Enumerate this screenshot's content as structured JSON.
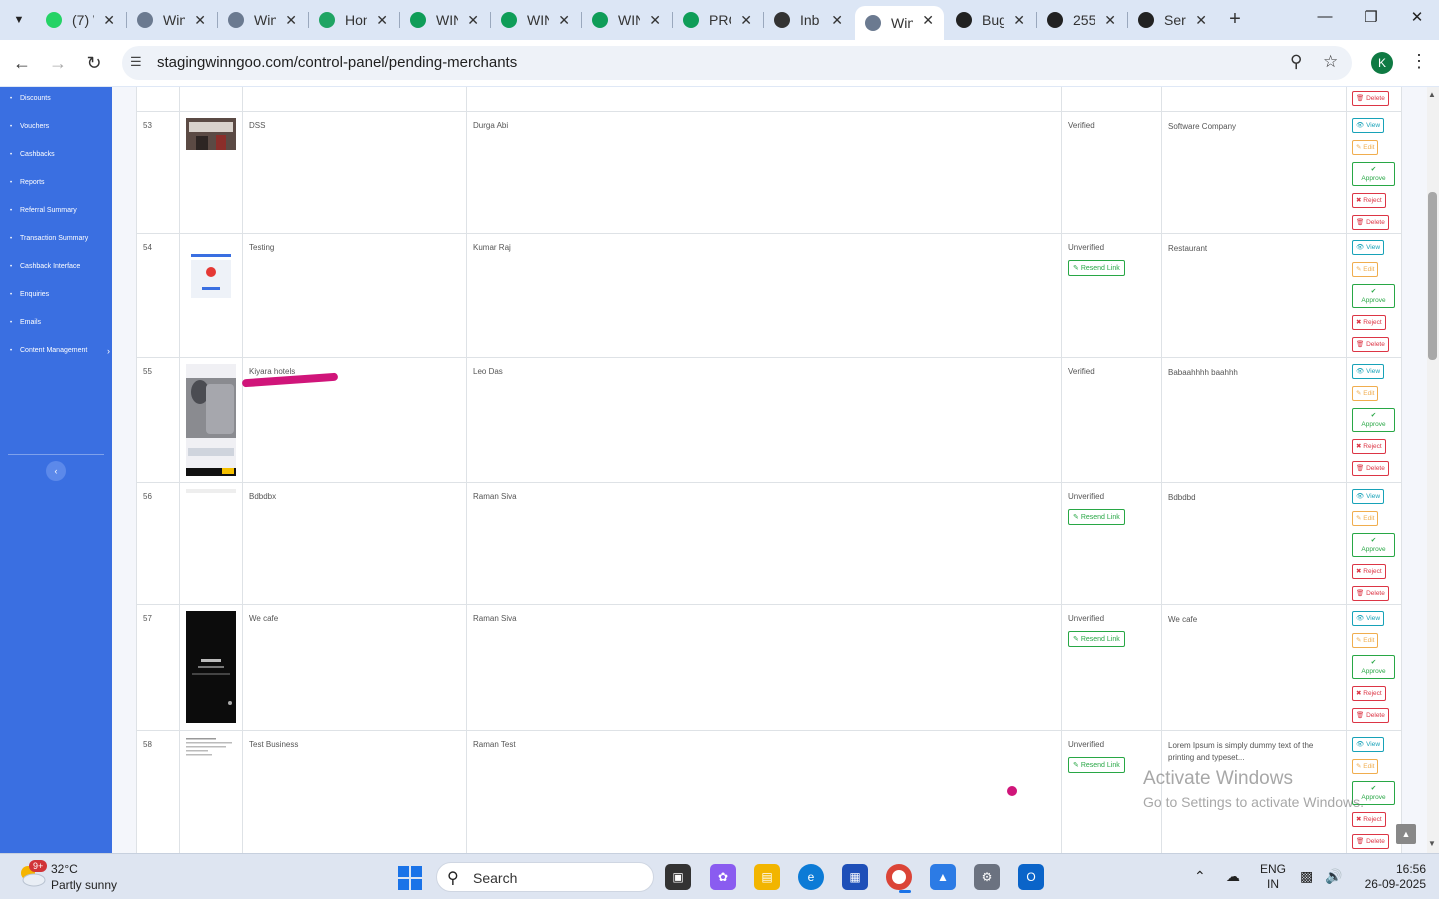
{
  "browser": {
    "tabs": [
      {
        "title": "(7) W",
        "favicon": "whatsapp-icon",
        "color": "#25d366"
      },
      {
        "title": "Win",
        "favicon": "globe-icon",
        "color": "#6b7a90"
      },
      {
        "title": "Win",
        "favicon": "globe-icon",
        "color": "#6b7a90"
      },
      {
        "title": "Hon",
        "favicon": "google-drive-icon",
        "color": "#1fa463"
      },
      {
        "title": "WIN",
        "favicon": "sheets-icon",
        "color": "#0f9d58"
      },
      {
        "title": "WIN",
        "favicon": "sheets-icon",
        "color": "#0f9d58"
      },
      {
        "title": "WIN",
        "favicon": "sheets-icon",
        "color": "#0f9d58"
      },
      {
        "title": "PRC",
        "favicon": "sheets-icon",
        "color": "#0f9d58"
      },
      {
        "title": "Inb",
        "favicon": "yahoo-icon",
        "color": "#333333"
      },
      {
        "title": "Win",
        "favicon": "globe-icon",
        "color": "#6b7a90"
      },
      {
        "title": "Bug",
        "favicon": "openai-icon",
        "color": "#222222"
      },
      {
        "title": "255",
        "favicon": "openai-icon",
        "color": "#222222"
      },
      {
        "title": "Ser",
        "favicon": "openai-icon",
        "color": "#222222"
      }
    ],
    "url": "stagingwinngoo.com/control-panel/pending-merchants",
    "avatar_letter": "K"
  },
  "sidebar": {
    "items": [
      {
        "label": "Discounts"
      },
      {
        "label": "Vouchers"
      },
      {
        "label": "Cashbacks"
      },
      {
        "label": "Reports"
      },
      {
        "label": "Referral Summary"
      },
      {
        "label": "Transaction Summary"
      },
      {
        "label": "Cashback Interface"
      },
      {
        "label": "Enquiries"
      },
      {
        "label": "Emails"
      },
      {
        "label": "Content Management"
      }
    ]
  },
  "table": {
    "actions": {
      "view": "View",
      "edit": "Edit",
      "approve": "Approve",
      "reject": "Reject",
      "delete": "Delete",
      "resend": "Resend Link"
    },
    "rows": [
      {
        "num": "53",
        "business": "DSS",
        "owner": "Durga Abi",
        "status": "Verified",
        "category": "Software Company",
        "resend": false
      },
      {
        "num": "54",
        "business": "Testing",
        "owner": "Kumar Raj",
        "status": "Unverified",
        "category": "Restaurant",
        "resend": true
      },
      {
        "num": "55",
        "business": "Kiyara hotels",
        "owner": "Leo Das",
        "status": "Verified",
        "category": "Babaahhhh baahhh",
        "resend": false
      },
      {
        "num": "56",
        "business": "Bdbdbx",
        "owner": "Raman Siva",
        "status": "Unverified",
        "category": "Bdbdbd",
        "resend": true
      },
      {
        "num": "57",
        "business": "We cafe",
        "owner": "Raman Siva",
        "status": "Unverified",
        "category": "We cafe",
        "resend": true
      },
      {
        "num": "58",
        "business": "Test Business",
        "owner": "Raman Test",
        "status": "Unverified",
        "category": "Lorem Ipsum is simply dummy text of the printing and typeset...",
        "resend": true
      }
    ]
  },
  "watermark": {
    "line1": "Activate Windows",
    "line2": "Go to Settings to activate Windows."
  },
  "taskbar": {
    "weather_badge": "9+",
    "temperature": "32°C",
    "weather": "Partly sunny",
    "search_label": "Search",
    "lang_line1": "ENG",
    "lang_line2": "IN",
    "time": "16:56",
    "date": "26-09-2025"
  }
}
